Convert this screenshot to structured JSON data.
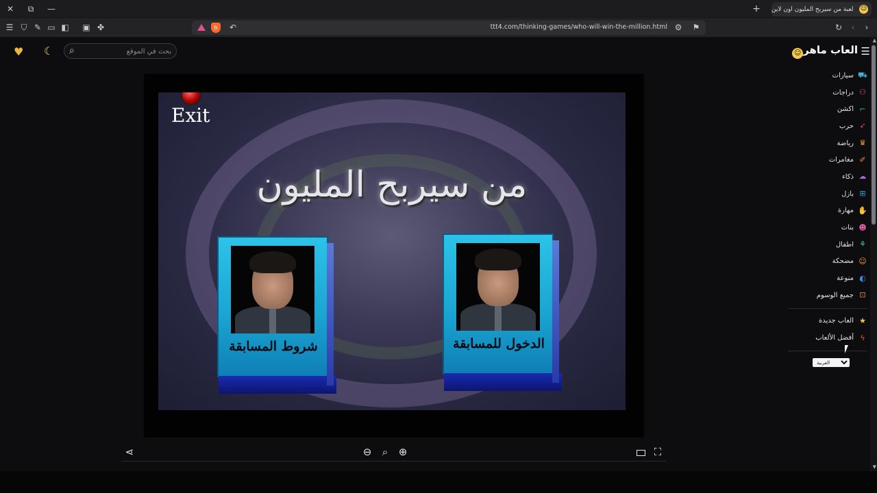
{
  "browser": {
    "tab_title": "لعبة من سيربح المليون اون لاين",
    "url": "ttt4.com/thinking-games/who-will-win-the-million.html",
    "window_buttons": {
      "close": "✕",
      "restore": "⧉",
      "minimize": "—"
    },
    "new_tab": "+",
    "tab_close": "✕"
  },
  "header": {
    "logo_text": "العاب ماهر",
    "search_placeholder": "بحث في الموقع"
  },
  "sidebar": {
    "categories": [
      {
        "label": "سيارات",
        "icon": "car-icon",
        "color": "#3bb6d9"
      },
      {
        "label": "دراجات",
        "icon": "bike-icon",
        "color": "#e0508a"
      },
      {
        "label": "اكشن",
        "icon": "gun-icon",
        "color": "#4cc36b"
      },
      {
        "label": "حرب",
        "icon": "rocket-icon",
        "color": "#e04a55"
      },
      {
        "label": "رياضة",
        "icon": "trophy-icon",
        "color": "#f09a3a"
      },
      {
        "label": "مغامرات",
        "icon": "brush-icon",
        "color": "#f08a4a"
      },
      {
        "label": "ذكاء",
        "icon": "brain-icon",
        "color": "#a06ae0"
      },
      {
        "label": "بازل",
        "icon": "puzzle-icon",
        "color": "#3a9ae0"
      },
      {
        "label": "مهارة",
        "icon": "hand-icon",
        "color": "#5ac36b"
      },
      {
        "label": "بنات",
        "icon": "girl-icon",
        "color": "#e05aa0"
      },
      {
        "label": "اطفال",
        "icon": "kids-icon",
        "color": "#3ac3b0"
      },
      {
        "label": "مضحكة",
        "icon": "smile-icon",
        "color": "#f0a03a"
      },
      {
        "label": "منوعة",
        "icon": "mix-icon",
        "color": "#3a8ae0"
      },
      {
        "label": "جميع الوسوم",
        "icon": "grid-icon",
        "color": "#e08a4a"
      }
    ],
    "extras": [
      {
        "label": "العاب جديدة",
        "icon": "star-icon",
        "color": "#f2c94c"
      },
      {
        "label": "أفضل الألعاب",
        "icon": "bolt-icon",
        "color": "#f05a3a"
      }
    ],
    "language": "العربية"
  },
  "game": {
    "exit_label": "Exit",
    "title": "من سيربح المليون",
    "rules_card": "شروط المسابقة",
    "enter_card": "الدخول للمسابقة"
  }
}
